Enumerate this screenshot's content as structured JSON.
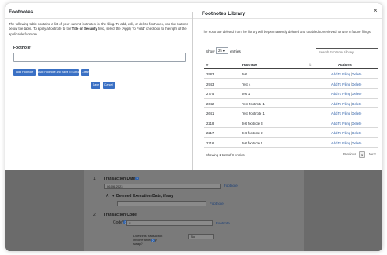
{
  "modal": {
    "title": "Footnotes",
    "close_glyph": "×"
  },
  "left": {
    "intro_part1": "The following table contains a list of your current footnotes for the filing. To add, edit, or delete footnotes, use the buttons below the table. To apply a footnote to the ",
    "intro_bold": "Title of Security",
    "intro_part2": " field, select the \"Apply To Field\" checkbox to the right of the applicable footnote",
    "field_label": "Footnote*",
    "field_value": "",
    "buttons": {
      "add": "Add Footnote",
      "add_save": "Add Footnote and Save To Library",
      "clear": "Clear",
      "save": "Save",
      "cancel": "Cancel"
    }
  },
  "library": {
    "title": "Footnotes Library",
    "note": "The Footnote deleted from the library will be permanently deleted and unabled to retrieved for use in future filings",
    "show_label": "Show",
    "page_size": "25",
    "entries_label": "entries",
    "search_placeholder": "Search Footnote Library...",
    "columns": [
      "#",
      "Footnote",
      "Actions"
    ],
    "sort_glyph": "⇅",
    "rows": [
      {
        "id": "2983",
        "footnote": "test",
        "action_add": "Add To Filing",
        "sep": "|",
        "action_delete": "Delete"
      },
      {
        "id": "2943",
        "footnote": "Test 4",
        "action_add": "Add To Filing",
        "sep": "|",
        "action_delete": "Delete"
      },
      {
        "id": "2775",
        "footnote": "test 1",
        "action_add": "Add To Filing",
        "sep": "|",
        "action_delete": "Delete"
      },
      {
        "id": "2642",
        "footnote": "Test Footnote 1",
        "action_add": "Add To Filing",
        "sep": "|",
        "action_delete": "Delete"
      },
      {
        "id": "2641",
        "footnote": "Test Footnote 1",
        "action_add": "Add To Filing",
        "sep": "|",
        "action_delete": "Delete"
      },
      {
        "id": "2218",
        "footnote": "test footnote 3",
        "action_add": "Add To Filing",
        "sep": "|",
        "action_delete": "Delete"
      },
      {
        "id": "2217",
        "footnote": "test footnote 2",
        "action_add": "Add To Filing",
        "sep": "|",
        "action_delete": "Delete"
      },
      {
        "id": "2216",
        "footnote": "test footnote 1",
        "action_add": "Add To Filing",
        "sep": "|",
        "action_delete": "Delete"
      }
    ],
    "info": "Showing 1 to 8 of 8 entries",
    "pagination": {
      "previous": "Previous",
      "page": "1",
      "next": "Next"
    }
  },
  "background": {
    "row1_num": "1",
    "transaction_date_label": "Transaction Date*",
    "transaction_date_value": "06-06-2023",
    "footnote_link": "Footnote",
    "row2_letter": "A",
    "deemed_label": "Deemed Execution Date, if any",
    "row3_num": "2",
    "transaction_code_label": "Transaction Code",
    "code_label": "Code*",
    "code_value": "S",
    "voluntary_question": "Does this transaction involve an equity swap?",
    "voluntary_value": "No",
    "help_glyph": "?"
  },
  "colors": {
    "primary_button": "#3a70c4",
    "link": "#2d5fa8",
    "overlay": "#6b6b6b"
  }
}
